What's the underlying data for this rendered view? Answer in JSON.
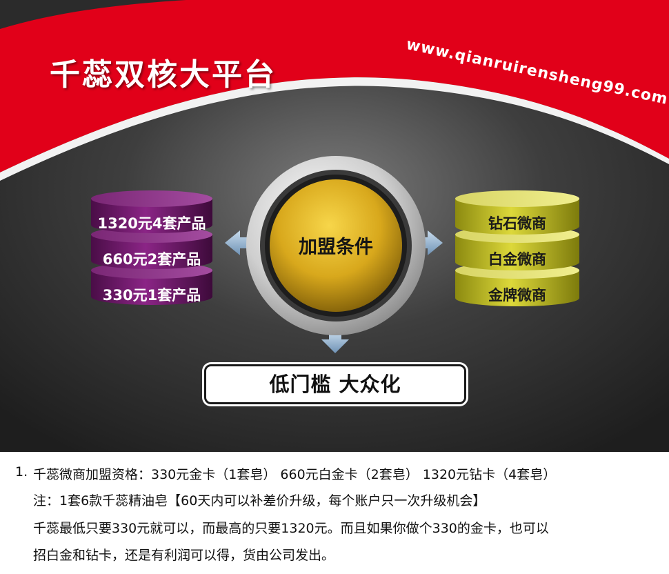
{
  "banner": {
    "title": "千蕊双核大平台",
    "url": "www.qianruirensheng99.com",
    "left_options": [
      "1320元4套产品",
      "660元2套产品",
      "330元1套产品"
    ],
    "center_label": "加盟条件",
    "right_options": [
      "钻石微商",
      "白金微商",
      "金牌微商"
    ],
    "bottom_label": "低门槛 大众化",
    "colors": {
      "red": "#e10019",
      "dark_bg": "#2e2e2e",
      "purple": "#7a1a73",
      "gold": "#d4b020",
      "olive": "#c9c41d"
    }
  },
  "notes": {
    "number": "1.",
    "line1": "千蕊微商加盟资格：330元金卡（1套皂） 660元白金卡（2套皂） 1320元钻卡（4套皂）",
    "line2": "注：1套6款千蕊精油皂【60天内可以补差价升级，每个账户只一次升级机会】",
    "line3": "千蕊最低只要330元就可以，而最高的只要1320元。而且如果你做个330的金卡，也可以",
    "line4": "招白金和钻卡，还是有利润可以得，货由公司发出。"
  }
}
